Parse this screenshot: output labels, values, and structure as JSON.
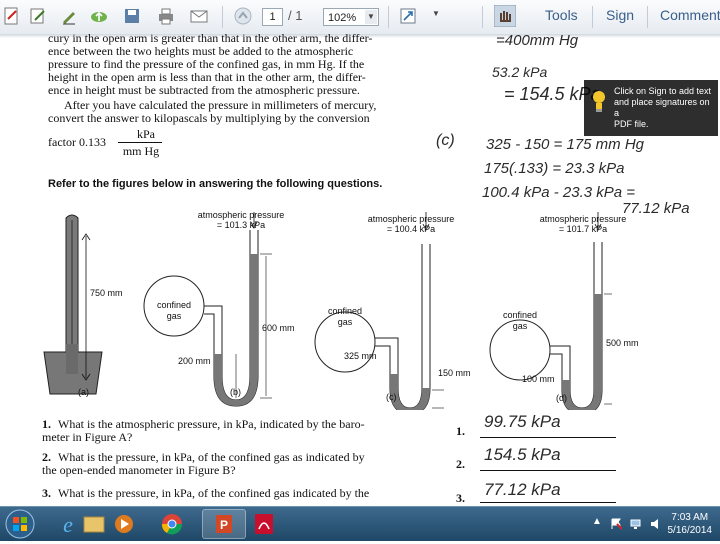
{
  "toolbar": {
    "page_current": "1",
    "page_total": "/ 1",
    "zoom": "102%",
    "tools_label": "Tools",
    "sign_label": "Sign",
    "comment_label": "Comment"
  },
  "tooltip": {
    "text_lines": [
      "Click on Sign to add text",
      "and place signatures on a",
      "PDF file."
    ]
  },
  "document": {
    "intro_lines": [
      "cury in the open arm is greater than that in the other arm, the differ-",
      "ence between the two heights must be added to the atmospheric",
      "pressure to find the pressure of the confined gas, in mm Hg. If the",
      "height in the open arm is less than that in the other arm, the differ-",
      "ence in height must be subtracted from the atmospheric pressure.",
      "After you have calculated the pressure in millimeters of mercury,",
      "convert the answer to kilopascals by multiplying by the conversion"
    ],
    "factor_prefix": "factor 0.133",
    "factor_numerator": "kPa",
    "factor_denominator": "mm Hg",
    "instruction": "Refer to the figures below in answering the following questions.",
    "figures": {
      "a": {
        "label": "(a)",
        "height": "750 mm"
      },
      "b": {
        "label": "(b)",
        "atm_title": "atmospheric pressure",
        "atm_value": "= 101.3 kPa",
        "gas": [
          "confined",
          "gas"
        ],
        "h_open": "600 mm",
        "h_closed": "200 mm"
      },
      "c": {
        "label": "(c)",
        "atm_title": "atmospheric pressure",
        "atm_value": "= 100.4 kPa",
        "gas": [
          "confined",
          "gas"
        ],
        "h_closed": "325 mm",
        "h_diff": "150 mm"
      },
      "d": {
        "label": "(d)",
        "atm_title": "atmospheric pressure",
        "atm_value": "= 101.7 kPa",
        "gas": [
          "confined",
          "gas"
        ],
        "h_open": "500 mm",
        "h_closed": "100 mm"
      }
    },
    "questions": [
      {
        "num": "1.",
        "lines": [
          "What is the atmospheric pressure, in kPa, indicated by the baro-",
          "meter in Figure A?"
        ],
        "ans_num": "1.",
        "answer": "99.75 kPa"
      },
      {
        "num": "2.",
        "lines": [
          "What is the pressure, in kPa, of the confined gas as indicated by",
          "the open-ended manometer in Figure B?"
        ],
        "ans_num": "2.",
        "answer": "154.5 kPa"
      },
      {
        "num": "3.",
        "lines": [
          "What is the pressure, in kPa, of the confined gas indicated by the"
        ],
        "ans_num": "3.",
        "answer": "77.12 kPa"
      }
    ],
    "handwriting": {
      "n1": "=400mm Hg",
      "n2": "53.2 kPa",
      "n3": "= 154.5 kPa",
      "c_label": "(c)",
      "c1": "325 - 150 = 175 mm Hg",
      "c2": "175(.133) = 23.3 kPa",
      "c3": "100.4 kPa - 23.3 kPa =",
      "c4": "77.12 kPa"
    }
  },
  "taskbar": {
    "time": "7:03 AM",
    "date": "5/16/2014"
  },
  "colors": {
    "taskbar": "#2c5678",
    "tooltip_bg": "#1a1a1a",
    "link": "#3a5f8a"
  }
}
